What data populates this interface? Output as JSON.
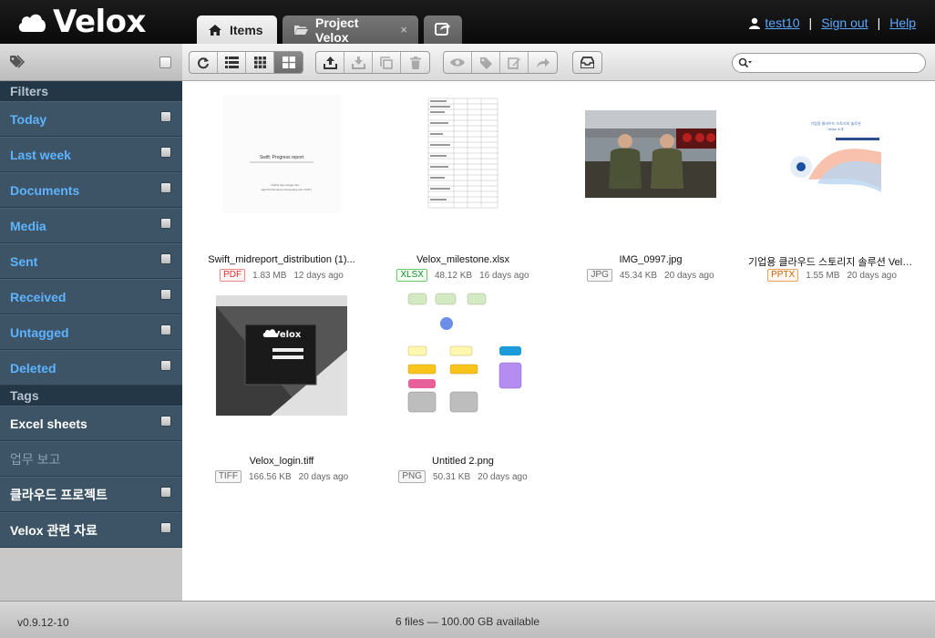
{
  "app": {
    "name": "Velox"
  },
  "tabs": [
    {
      "label": "Items",
      "icon": "home-icon"
    },
    {
      "label": "Project Velox",
      "icon": "folder-open-icon",
      "close": "×"
    },
    {
      "label": "",
      "icon": "share-icon"
    }
  ],
  "user": {
    "name": "test10",
    "signout": "Sign out",
    "help": "Help",
    "separator": "|"
  },
  "toolbar": {
    "groups": [
      [
        "refresh-icon",
        "list-view-icon",
        "grid-small-icon",
        "grid-large-icon"
      ],
      [
        "upload-icon",
        "download-icon",
        "copy-icon",
        "trash-icon"
      ],
      [
        "eye-icon",
        "tag-icon",
        "edit-icon",
        "forward-icon"
      ],
      [
        "inbox-icon"
      ]
    ],
    "active_view": "grid-large-icon",
    "search": {
      "placeholder": ""
    }
  },
  "sidebar": {
    "filters_header": "Filters",
    "filters": [
      "Today",
      "Last week",
      "Documents",
      "Media",
      "Sent",
      "Received",
      "Untagged",
      "Deleted"
    ],
    "tags_header": "Tags",
    "tags": [
      "Excel sheets",
      "업무 보고",
      "클라우드 프로젝트",
      "Velox 관련 자료"
    ]
  },
  "files": [
    {
      "name": "Swift_midreport_distribution (1)...",
      "type": "PDF",
      "size": "1.83 MB",
      "date": "12 days ago",
      "thumb_lines": [
        "Swift: Progress report",
        "Hybrid Jae Gongjo Kim...",
        "High Performance Computing Lab / KISTI"
      ]
    },
    {
      "name": "Velox_milestone.xlsx",
      "type": "XLSX",
      "size": "48.12 KB",
      "date": "16 days ago"
    },
    {
      "name": "IMG_0997.jpg",
      "type": "JPG",
      "size": "45.34 KB",
      "date": "20 days ago"
    },
    {
      "name": "기업용 클라우드 스토리지 솔루션 Velox ...",
      "type": "PPTX",
      "size": "1.55 MB",
      "date": "20 days ago",
      "thumb_lines": [
        "기업용 클라우드 스토리지 솔루션",
        "Velox 소개"
      ]
    },
    {
      "name": "Velox_login.tiff",
      "type": "TIFF",
      "size": "166.56 KB",
      "date": "20 days ago",
      "thumb_lines": [
        "Velox"
      ]
    },
    {
      "name": "Untitled 2.png",
      "type": "PNG",
      "size": "50.31 KB",
      "date": "20 days ago"
    }
  ],
  "footer": {
    "version": "v0.9.12-10",
    "status": "6 files — 100.00 GB available"
  },
  "colors": {
    "accent_link": "#5aa9ff",
    "sidebar_bg": "#3d5466",
    "sidebar_header": "#243747",
    "header_bg": "#111111"
  }
}
